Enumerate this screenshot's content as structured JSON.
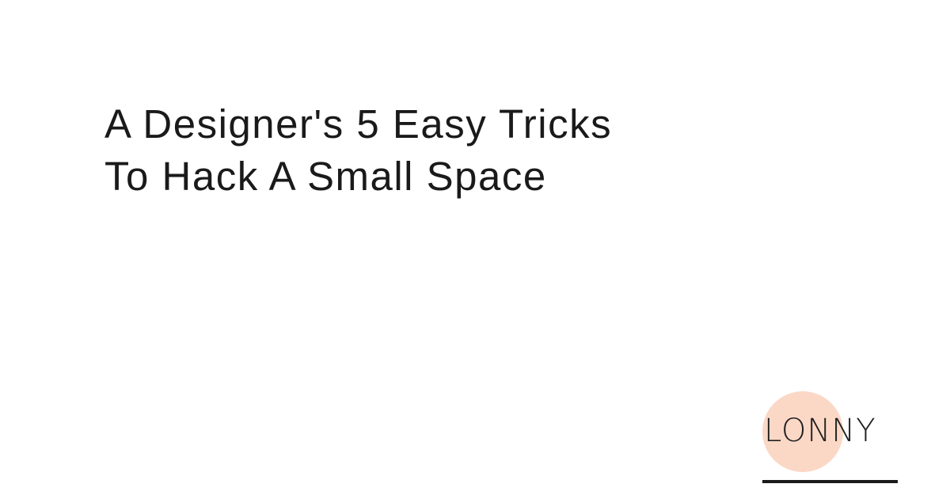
{
  "headline": {
    "line1": "A Designer's 5 Easy Tricks",
    "line2": "To Hack A Small Space"
  },
  "brand": {
    "name": "LONNY",
    "circle_color": "#fbd8c6",
    "rule_color": "#1a1a1a"
  }
}
